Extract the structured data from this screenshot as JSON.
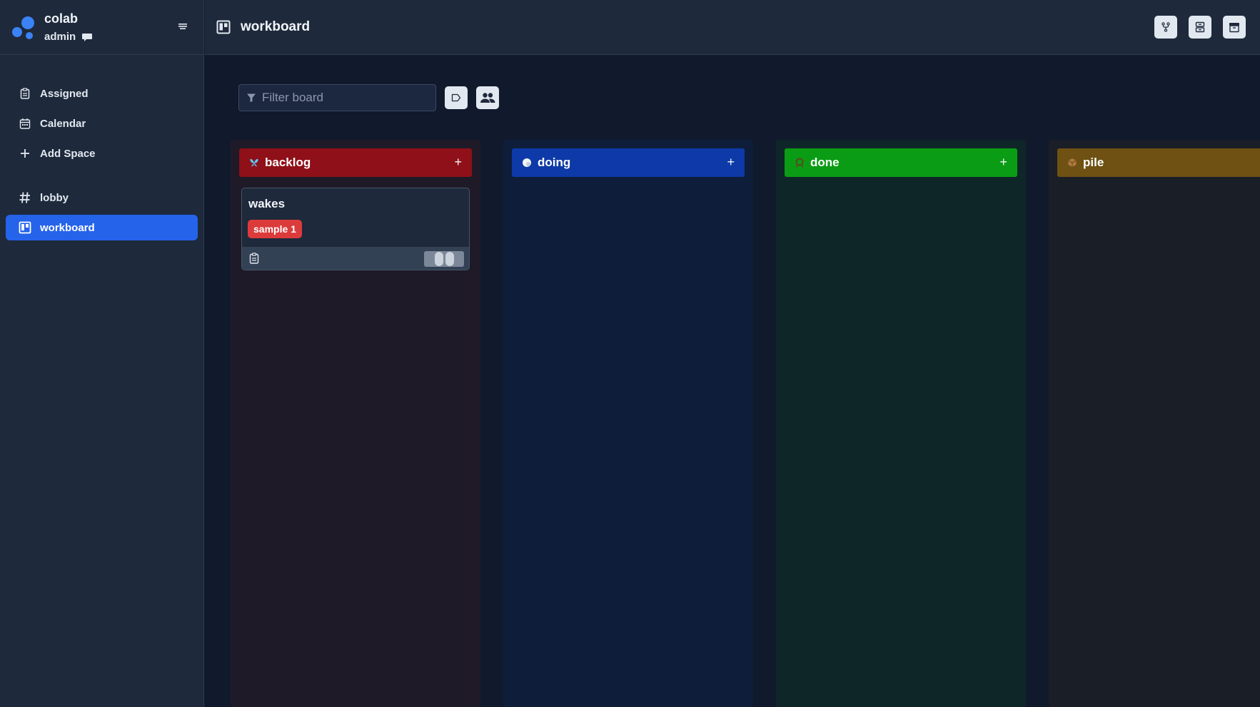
{
  "app": {
    "name": "colab",
    "user": "admin"
  },
  "sidebar": {
    "items": [
      {
        "label": "Assigned",
        "icon": "clipboard-icon"
      },
      {
        "label": "Calendar",
        "icon": "calendar-icon"
      },
      {
        "label": "Add Space",
        "icon": "plus-icon"
      },
      {
        "label": "lobby",
        "icon": "hash-icon"
      },
      {
        "label": "workboard",
        "icon": "board-icon",
        "active": true
      }
    ]
  },
  "header": {
    "title": "workboard",
    "actions": [
      "fork-icon",
      "server-icon",
      "archive-icon"
    ]
  },
  "toolbar": {
    "filter_placeholder": "Filter board",
    "filter_value": ""
  },
  "columns": [
    {
      "name": "backlog",
      "icon": "butterfly-icon",
      "color": "#8f1018",
      "body": "#1f1a28",
      "add_label": "+"
    },
    {
      "name": "doing",
      "icon": "circle-icon",
      "color": "#0d3aa8",
      "body": "#0e1d3a",
      "add_label": "+"
    },
    {
      "name": "done",
      "icon": "wreath-icon",
      "color": "#0b9c15",
      "body": "#0f2628",
      "add_label": "+"
    },
    {
      "name": "pile",
      "icon": "box-icon",
      "color": "#6e5113",
      "body": "#1a1e26",
      "add_label": "+"
    }
  ],
  "cards": [
    {
      "title": "wakes",
      "tag": "sample 1",
      "tag_color": "#dc3b3b"
    }
  ]
}
